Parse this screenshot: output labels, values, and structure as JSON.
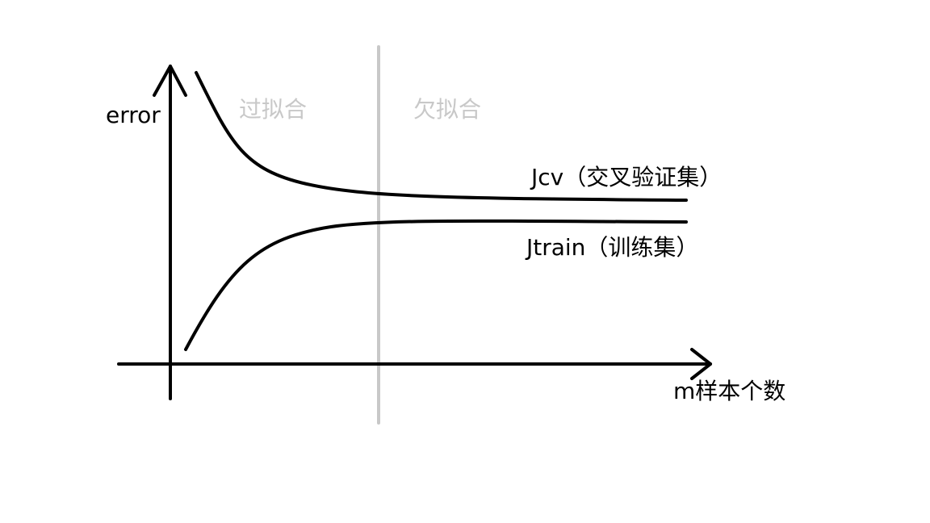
{
  "labels": {
    "y_axis": "error",
    "x_axis": "m样本个数",
    "region_left": "过拟合",
    "region_right": "欠拟合",
    "curve_cv": "Jcv（交叉验证集）",
    "curve_train": "Jtrain（训练集）"
  },
  "colors": {
    "ink": "#000000",
    "divider": "#c8c8c8",
    "region_text": "#c8c8c8",
    "background": "#ffffff"
  }
}
